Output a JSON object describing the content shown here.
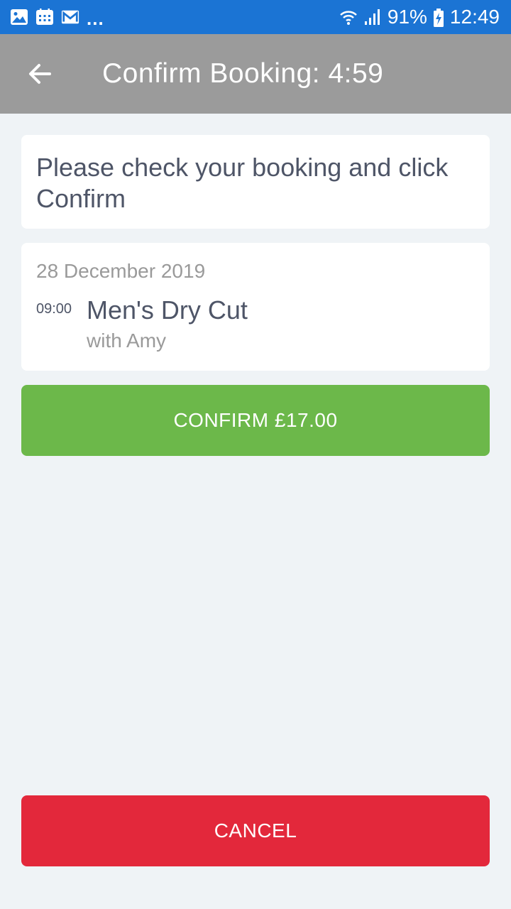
{
  "status_bar": {
    "icons_left": [
      "gallery-icon",
      "calendar-icon",
      "gmail-icon"
    ],
    "overflow": "...",
    "battery": "91%",
    "time": "12:49",
    "background_color": "#1b74d4"
  },
  "toolbar": {
    "title": "Confirm Booking: 4:59",
    "back_icon": "arrow-left-icon",
    "background_color": "#9b9b9b"
  },
  "instruction": {
    "text": "Please check your booking and click Confirm"
  },
  "booking": {
    "date": "28 December 2019",
    "time": "09:00",
    "service": "Men's Dry Cut",
    "staff": "with Amy"
  },
  "buttons": {
    "confirm_label": "CONFIRM £17.00",
    "confirm_color": "#6cb84a",
    "cancel_label": "CANCEL",
    "cancel_color": "#e3283b"
  }
}
